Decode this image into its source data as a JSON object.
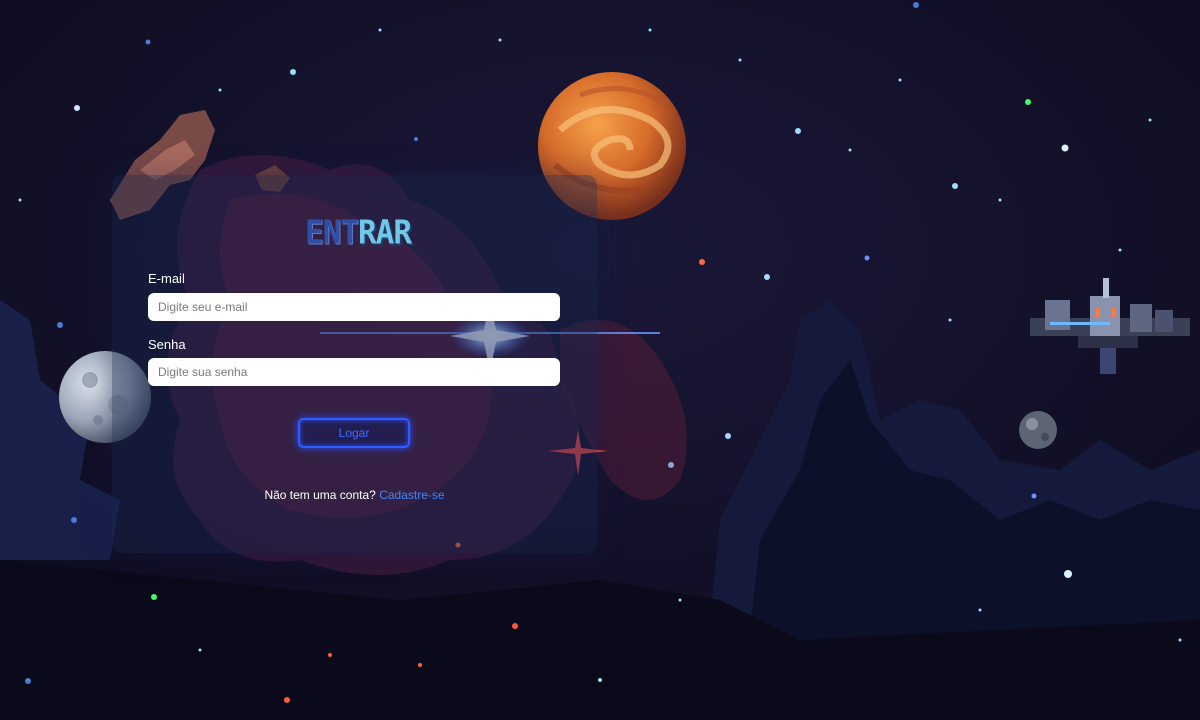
{
  "login": {
    "title_part_a": "ENT",
    "title_part_b": "RAR",
    "email_label": "E-mail",
    "email_placeholder": "Digite seu e-mail",
    "email_value": "",
    "password_label": "Senha",
    "password_placeholder": "Digite sua senha",
    "password_value": "",
    "submit_label": "Logar",
    "signup_prompt": "Não tem uma conta?",
    "signup_link": "Cadastre-se"
  },
  "colors": {
    "background": "#110f24",
    "accent_blue": "#2f5bff",
    "link_blue": "#3f86ff",
    "title_cyan": "#6ec8e6"
  },
  "background_art": {
    "icons": [
      "orange-planet-icon",
      "moon-icon",
      "space-station-icon",
      "asteroid-icon",
      "nebula-icon",
      "star-icon"
    ]
  }
}
